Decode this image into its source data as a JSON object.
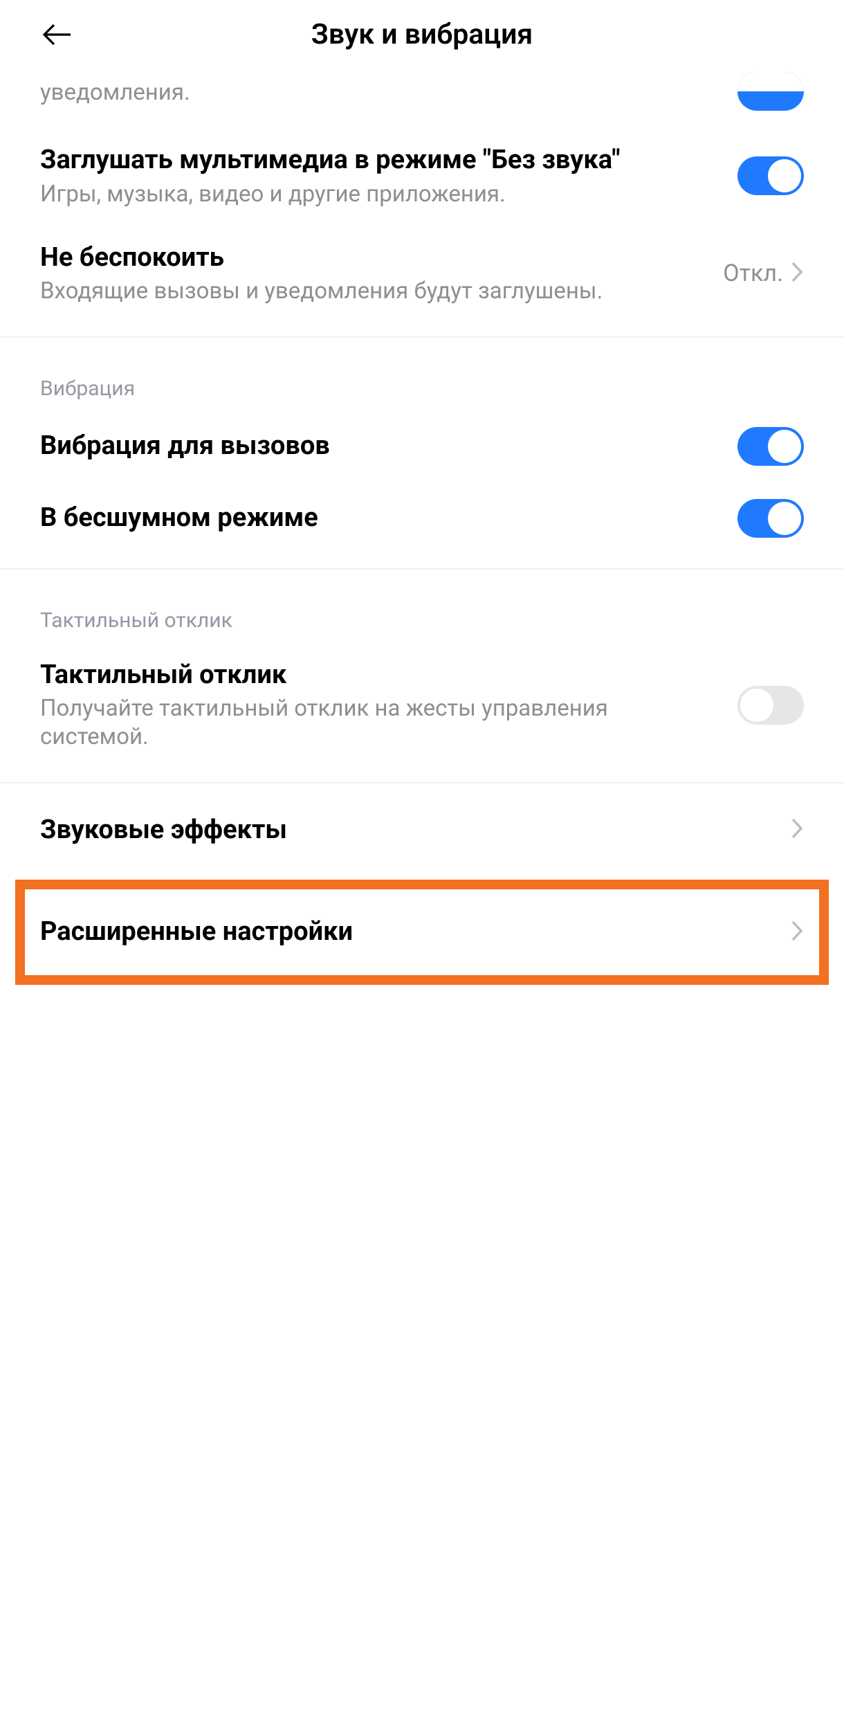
{
  "header": {
    "title": "Звук и вибрация"
  },
  "partial": {
    "sub": "уведомления."
  },
  "muteMedia": {
    "title": "Заглушать мультимедиа в режиме \"Без звука\"",
    "sub": "Игры, музыка, видео и другие приложения.",
    "on": true
  },
  "dnd": {
    "title": "Не беспокоить",
    "sub": "Входящие вызовы и уведомления будут заглушены.",
    "value": "Откл."
  },
  "sectionVibration": "Вибрация",
  "vibrateCalls": {
    "title": "Вибрация для вызовов",
    "on": true
  },
  "vibrateSilent": {
    "title": "В бесшумном режиме",
    "on": true
  },
  "sectionHaptic": "Тактильный отклик",
  "haptic": {
    "title": "Тактильный отклик",
    "sub": "Получайте тактильный отклик на жесты управления системой.",
    "on": false
  },
  "soundEffects": {
    "title": "Звуковые эффекты"
  },
  "advanced": {
    "title": "Расширенные настройки"
  }
}
